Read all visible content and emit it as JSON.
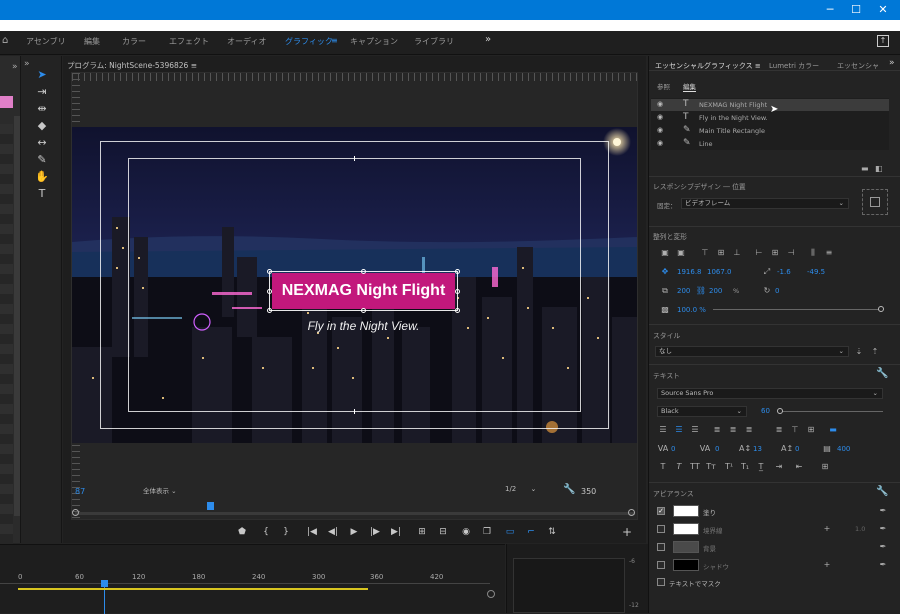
{
  "workspace_tabs": [
    {
      "label": "アセンブリ",
      "active": false
    },
    {
      "label": "編集",
      "active": false
    },
    {
      "label": "カラー",
      "active": false
    },
    {
      "label": "エフェクト",
      "active": false
    },
    {
      "label": "オーディオ",
      "active": false
    },
    {
      "label": "グラフィック",
      "active": true
    },
    {
      "label": "キャプション",
      "active": false
    },
    {
      "label": "ライブラリ",
      "active": false
    }
  ],
  "program": {
    "tab_label": "プログラム: NightScene-5396826",
    "title_text": "NEXMAG Night Flight",
    "subtitle_text": "Fly in the Night View.",
    "timecode_left": "87",
    "zoom": "全体表示",
    "resolution": "1/2",
    "timecode_right": "350"
  },
  "essential_graphics": {
    "tabs": [
      "エッセンシャルグラフィックス",
      "Lumetri カラー",
      "エッセンシャ"
    ],
    "subtabs": [
      "参照",
      "編集"
    ],
    "layers": [
      "NEXMAG Night Flight",
      "Fly in the Night View.",
      "Main Title Rectangle",
      "Line"
    ],
    "responsive": {
      "label": "レスポンシブデザイン ― 位置",
      "pin_label": "固定：",
      "pin_value": "ビデオフレーム"
    },
    "align_label": "整列と変形",
    "position": {
      "x": "1916.8",
      "y": "1067.0"
    },
    "anchor": {
      "x": "-1.6",
      "y": "-49.5"
    },
    "scale": {
      "w": "200",
      "h": "200",
      "unit": "%"
    },
    "rotation": "0",
    "opacity": "100.0 %",
    "style_label": "スタイル",
    "style_value": "なし",
    "text_label": "テキスト",
    "font": "Source Sans Pro",
    "font_style": "Black",
    "font_size": "60",
    "tracking_values": [
      "0",
      "0",
      "13",
      "0",
      "400"
    ],
    "appearance_label": "アピアランス",
    "appearance": [
      {
        "label": "塗り",
        "checked": true,
        "color": "#ffffff"
      },
      {
        "label": "境界線",
        "checked": false,
        "color": "#ffffff",
        "value": "1.0"
      },
      {
        "label": "背景",
        "checked": false,
        "color": "#4a4a4a"
      },
      {
        "label": "シャドウ",
        "checked": false,
        "color": "#000000"
      }
    ],
    "mask_label": "テキストでマスク"
  },
  "timeline": {
    "ticks": [
      "0",
      "60",
      "120",
      "180",
      "240",
      "300",
      "360",
      "420"
    ]
  },
  "mixer": {
    "ticks": [
      "-6",
      "-12"
    ]
  }
}
